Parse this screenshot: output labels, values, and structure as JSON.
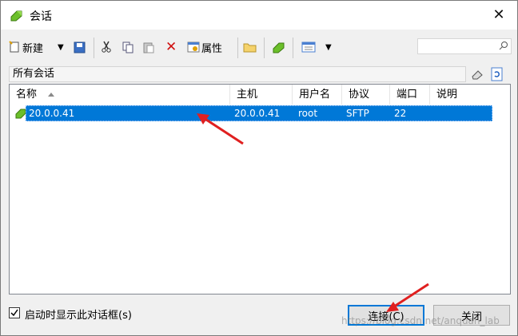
{
  "window": {
    "title": "会话"
  },
  "toolbar": {
    "new_label": "新建",
    "properties_label": "属性",
    "search_placeholder": ""
  },
  "group": {
    "label": "所有会话"
  },
  "table": {
    "columns": [
      "名称",
      "主机",
      "用户名",
      "协议",
      "端口",
      "说明"
    ],
    "rows": [
      {
        "name": "20.0.0.41",
        "host": "20.0.0.41",
        "user": "root",
        "protocol": "SFTP",
        "port": "22",
        "desc": ""
      }
    ]
  },
  "footer": {
    "startup_checkbox_label": "启动时显示此对话框(s)",
    "startup_checked": true,
    "connect_label": "连接(C)",
    "close_label": "关闭"
  },
  "watermark": "https://blog.csdn.net/anquan_lab",
  "colors": {
    "selection": "#0078d7",
    "accent_arrow": "#e02020"
  }
}
